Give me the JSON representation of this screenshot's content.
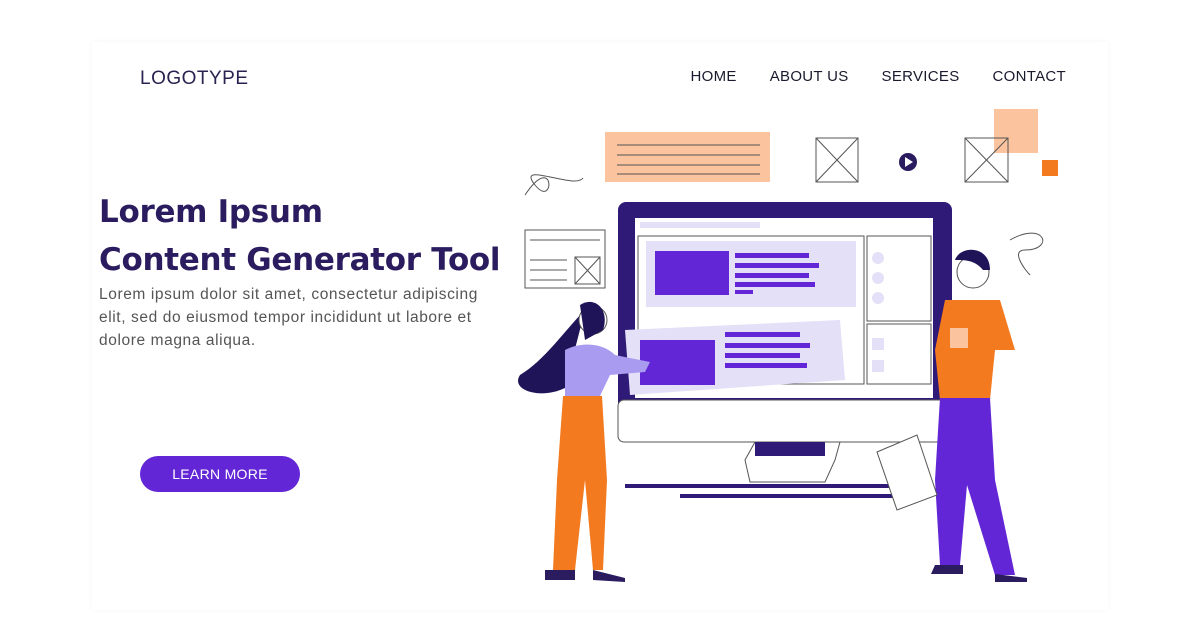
{
  "header": {
    "logo": "LOGOTYPE",
    "nav": [
      "HOME",
      "ABOUT US",
      "SERVICES",
      "CONTACT"
    ]
  },
  "hero": {
    "title_line1": "Lorem Ipsum",
    "title_line2": "Content Generator Tool",
    "description": "Lorem ipsum dolor sit amet, consectetur adipiscing elit, sed do eiusmod tempor incididunt ut labore et dolore magna aliqua.",
    "cta_label": "LEARN MORE"
  },
  "colors": {
    "accent": "#6326d6",
    "dark": "#2a1c5e",
    "orange": "#f47a20",
    "peach": "#fbc39e",
    "lavender": "#e4e0f7"
  },
  "illustration": {
    "icons": [
      "monitor-illustration",
      "woman-figure",
      "man-figure",
      "image-placeholder-icon",
      "play-icon"
    ]
  }
}
